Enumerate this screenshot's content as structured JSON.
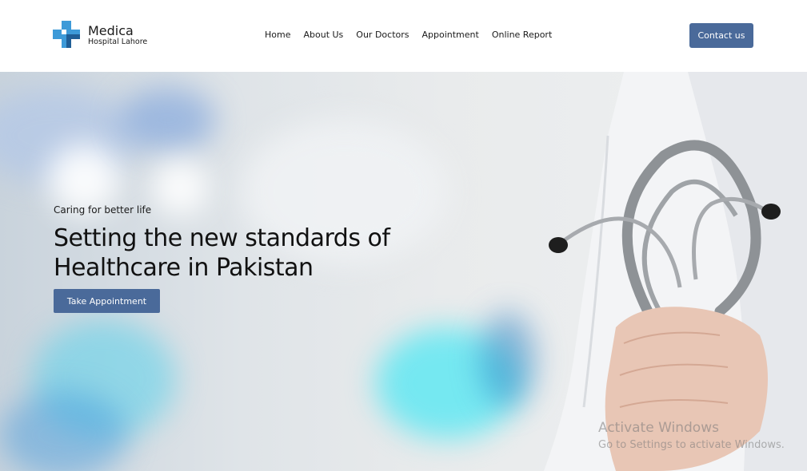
{
  "brand": {
    "name": "Medica",
    "subtitle": "Hospital Lahore",
    "logo_color_light": "#3d9ad8",
    "logo_color_dark": "#1f5e96"
  },
  "nav": {
    "items": [
      "Home",
      "About Us",
      "Our Doctors",
      "Appointment",
      "Online Report"
    ]
  },
  "header": {
    "contact_label": "Contact us"
  },
  "hero": {
    "tagline": "Caring for better life",
    "title_line1": "Setting the new standards of",
    "title_line2": "Healthcare in Pakistan",
    "button_label": "Take Appointment",
    "image": "doctor-with-stethoscope"
  },
  "watermark": {
    "title": "Activate Windows",
    "subtitle": "Go to Settings to activate Windows."
  },
  "colors": {
    "accent": "#4a6a9a",
    "text": "#1a1a1a"
  }
}
